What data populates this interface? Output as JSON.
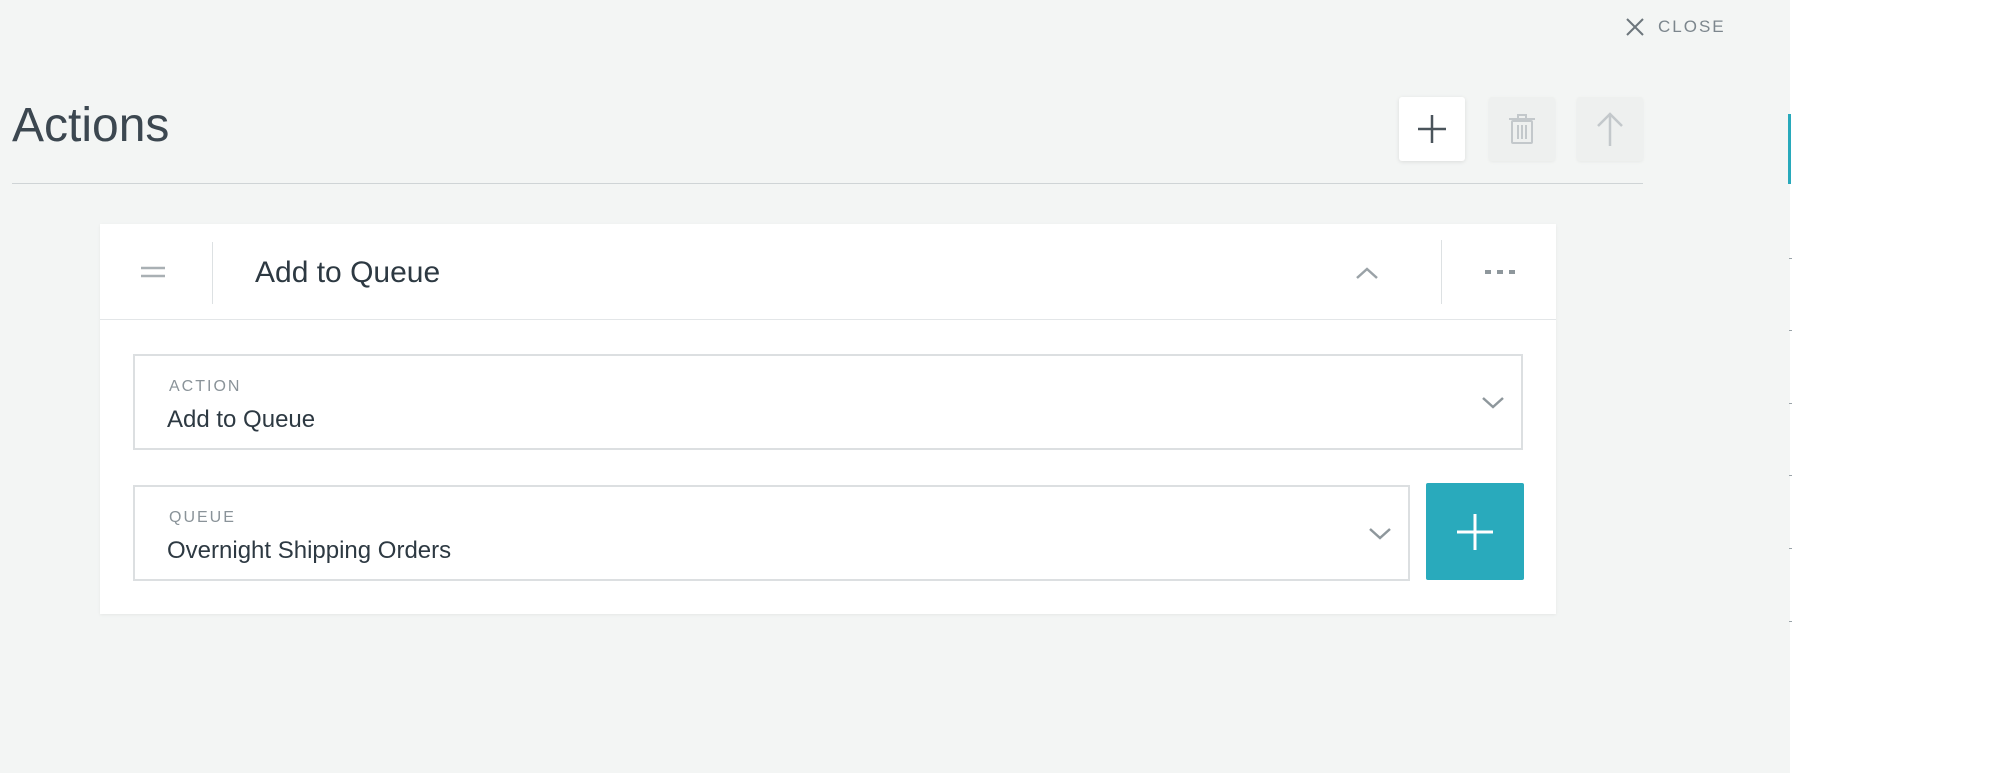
{
  "header": {
    "close_label": "CLOSE",
    "page_title": "Actions"
  },
  "toolbar": {
    "add_icon": "plus-icon",
    "delete_icon": "trash-icon",
    "move_up_icon": "arrow-up-icon"
  },
  "action_card": {
    "title": "Add to Queue",
    "action_field": {
      "label": "ACTION",
      "value": "Add to Queue"
    },
    "queue_field": {
      "label": "QUEUE",
      "value": "Overnight Shipping Orders"
    }
  },
  "colors": {
    "accent": "#29aabc",
    "panel_background": "#f3f5f4",
    "text": "#2d3942"
  }
}
